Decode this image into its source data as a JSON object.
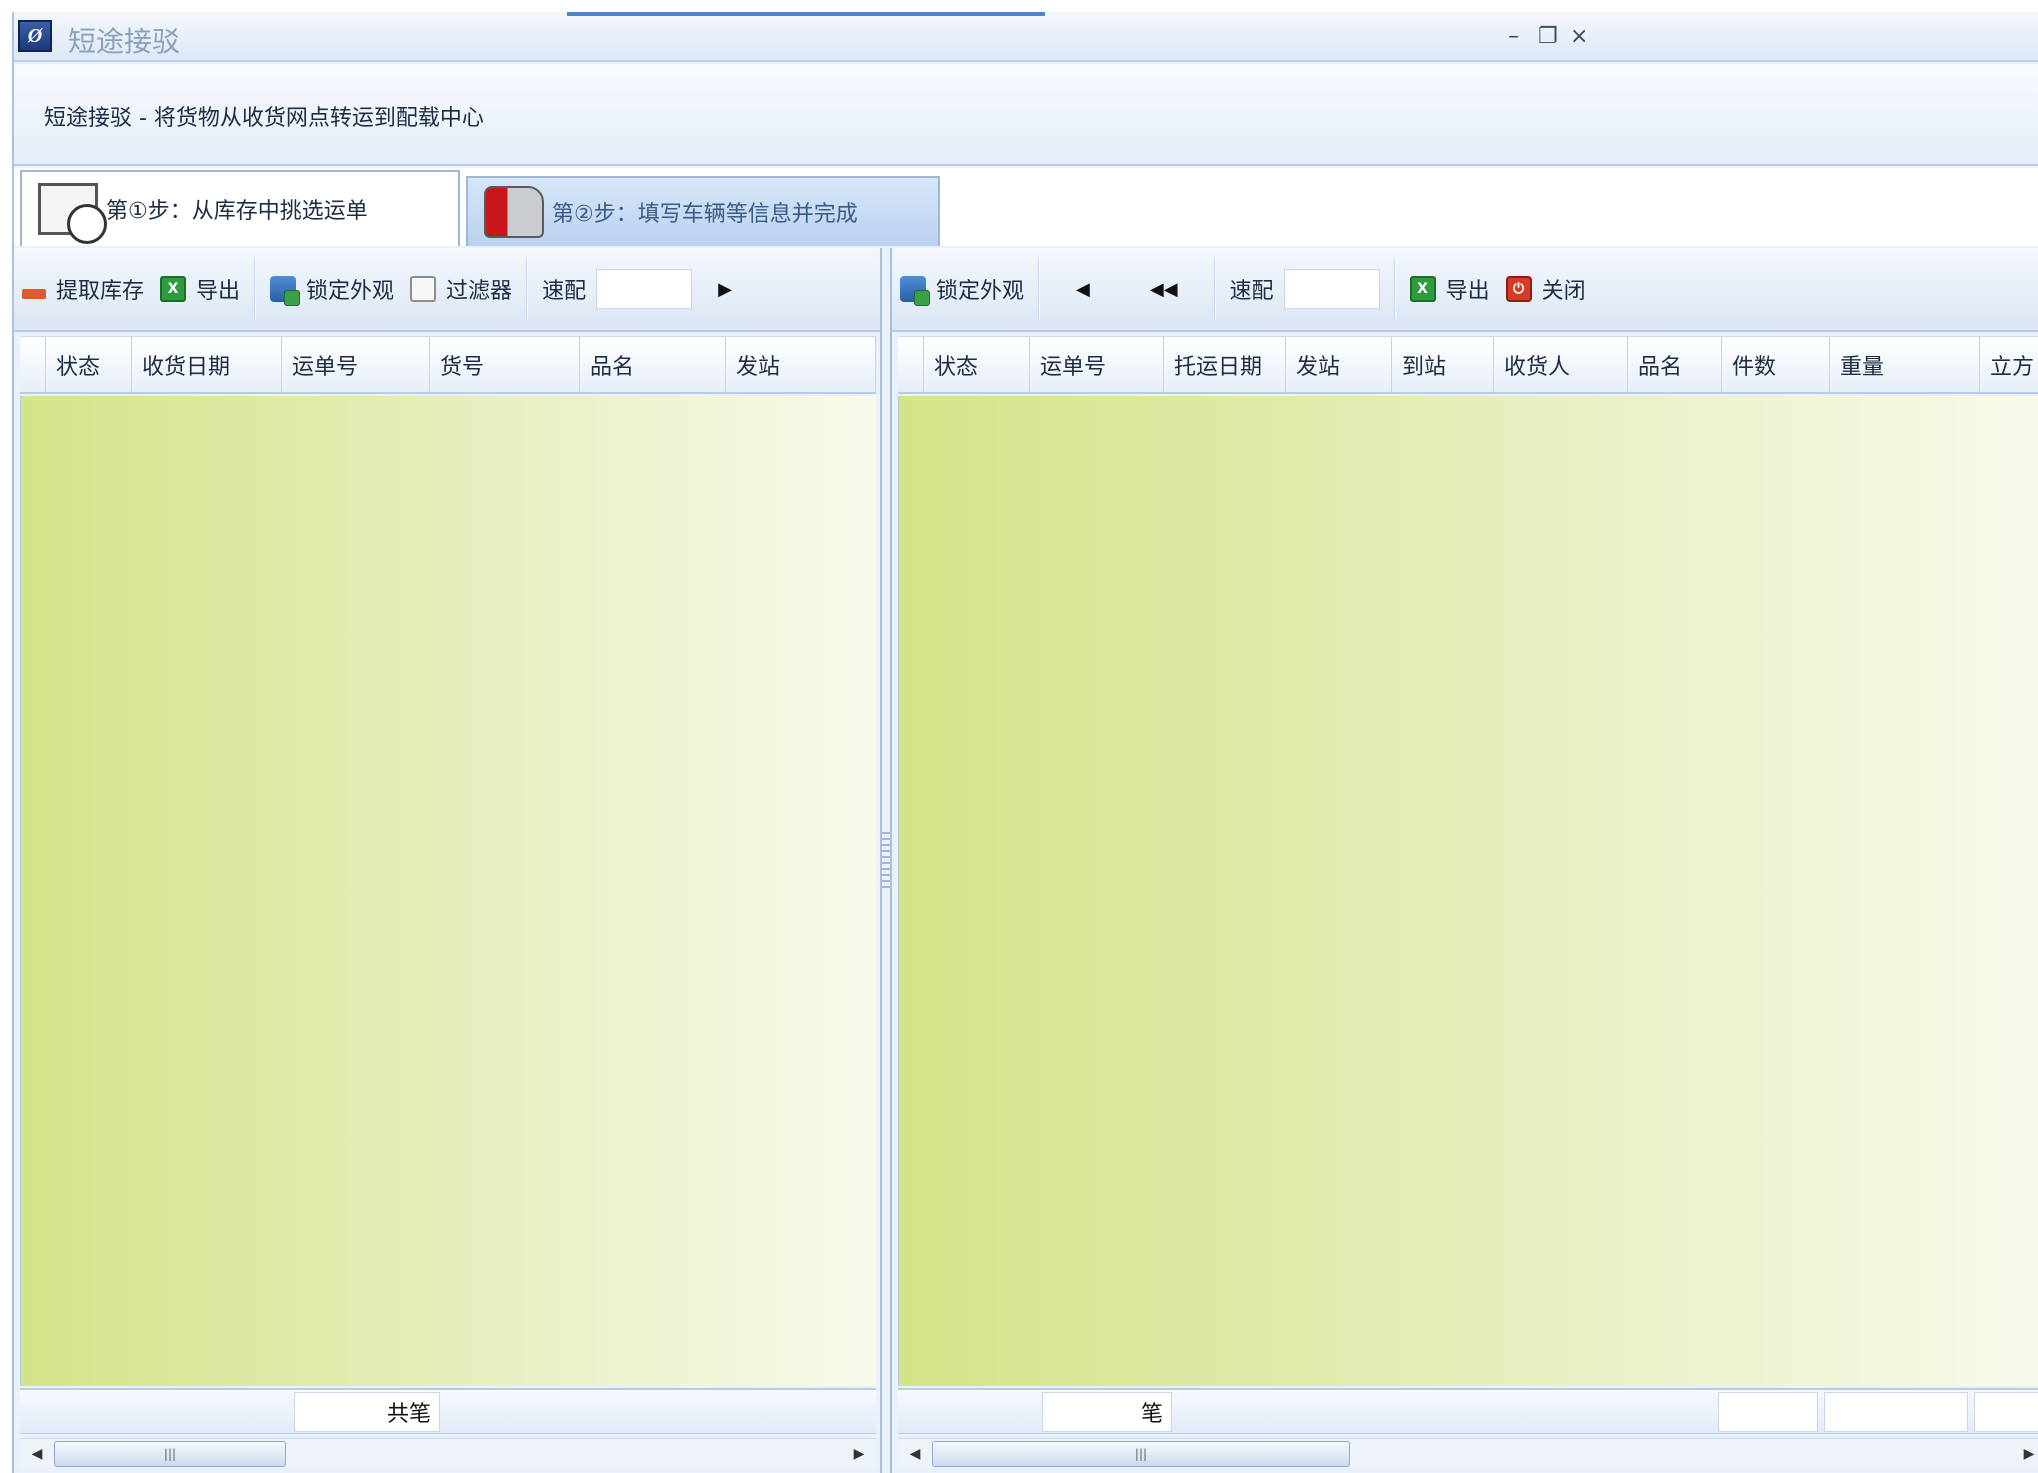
{
  "window": {
    "title": "短途接驳",
    "controls": [
      "–",
      "❐",
      "×"
    ]
  },
  "banner": {
    "text": "短途接驳 - 将货物从收货网点转运到配载中心"
  },
  "tabs": [
    {
      "label": "第①步：从库存中挑选运单",
      "icon": "calendar-clock-icon",
      "active": true
    },
    {
      "label": "第②步：填写车辆等信息并完成",
      "icon": "truck-icon",
      "active": false
    }
  ],
  "left_panel": {
    "toolbar": {
      "fetch_label": "提取库存",
      "export_label": "导出",
      "lock_label": "锁定外观",
      "filter_label": "过滤器",
      "quick_match_label": "速配",
      "quick_match_value": ""
    },
    "columns": [
      "状态",
      "收货日期",
      "运单号",
      "货号",
      "品名",
      "发站"
    ],
    "rows": [],
    "footer": {
      "count_label": "共笔"
    }
  },
  "right_panel": {
    "toolbar": {
      "lock_label": "锁定外观",
      "quick_match_label": "速配",
      "quick_match_value": "",
      "export_label": "导出",
      "close_label": "关闭"
    },
    "columns": [
      "状态",
      "运单号",
      "托运日期",
      "发站",
      "到站",
      "收货人",
      "品名",
      "件数",
      "重量",
      "立方"
    ],
    "rows": [],
    "footer": {
      "count_label": "笔"
    }
  },
  "colors": {
    "grid_gradient_start": "#d3e488",
    "grid_gradient_end": "#f7faeb",
    "chrome": "#eaf1fa"
  }
}
